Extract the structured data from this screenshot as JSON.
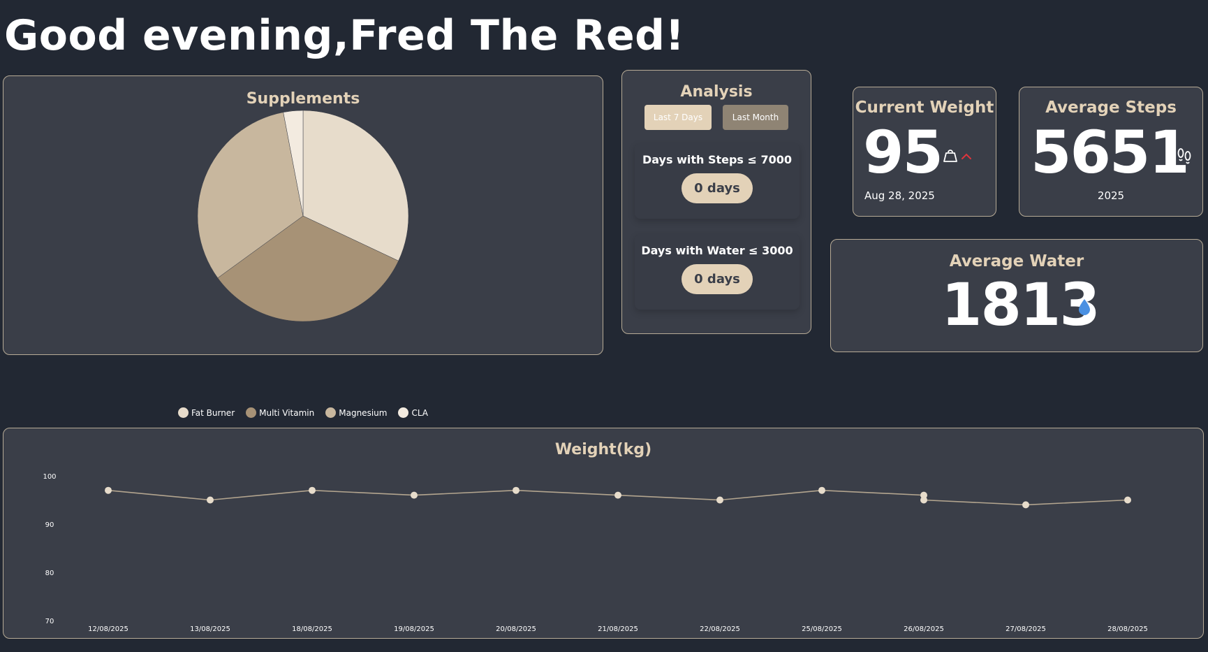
{
  "greeting": "Good evening,Fred The Red!",
  "supplements": {
    "title": "Supplements",
    "legend": [
      {
        "label": "Fat Burner",
        "color": "#e7dccb"
      },
      {
        "label": "Multi Vitamin",
        "color": "#a79276"
      },
      {
        "label": "Magnesium",
        "color": "#c8b79e"
      },
      {
        "label": "CLA",
        "color": "#f3ebe0"
      }
    ]
  },
  "chart_data": [
    {
      "type": "pie",
      "title": "Supplements",
      "categories": [
        "Fat Burner",
        "Multi Vitamin",
        "Magnesium",
        "CLA"
      ],
      "values": [
        32,
        33,
        32,
        3
      ],
      "colors": [
        "#e7dccb",
        "#a79276",
        "#c8b79e",
        "#f3ebe0"
      ],
      "legend_position": "bottom"
    },
    {
      "type": "line",
      "title": "Weight(kg)",
      "xlabel": "",
      "ylabel": "",
      "x": [
        "12/08/2025",
        "13/08/2025",
        "18/08/2025",
        "19/08/2025",
        "20/08/2025",
        "21/08/2025",
        "22/08/2025",
        "25/08/2025",
        "26/08/2025",
        "26/08/2025",
        "27/08/2025",
        "28/08/2025"
      ],
      "x_ticks": [
        "12/08/2025",
        "13/08/2025",
        "18/08/2025",
        "19/08/2025",
        "20/08/2025",
        "21/08/2025",
        "22/08/2025",
        "25/08/2025",
        "26/08/2025",
        "27/08/2025",
        "28/08/2025"
      ],
      "series": [
        {
          "values": [
            97,
            95,
            97,
            96,
            97,
            96,
            95,
            97,
            96,
            95,
            94,
            95
          ]
        }
      ],
      "ylim": [
        70,
        100
      ],
      "y_ticks": [
        70,
        80,
        90,
        100
      ],
      "grid": false,
      "color": "#b3a58f"
    }
  ],
  "analysis": {
    "title": "Analysis",
    "btn_last7": "Last 7 Days",
    "btn_lastmonth": "Last Month",
    "steps_label": "Days with Steps ≤ 7000",
    "steps_value": "0 days",
    "water_label": "Days with Water ≤ 3000",
    "water_value": "0 days"
  },
  "current_weight": {
    "title": "Current Weight",
    "value": "95",
    "date": "Aug 28, 2025",
    "trend_color": "#e0343c"
  },
  "average_steps": {
    "title": "Average Steps",
    "value": "5651",
    "year": "2025"
  },
  "average_water": {
    "title": "Average Water",
    "value": "1813",
    "icon_color": "#4a90e2"
  },
  "weight_chart": {
    "title": "Weight(kg)"
  }
}
